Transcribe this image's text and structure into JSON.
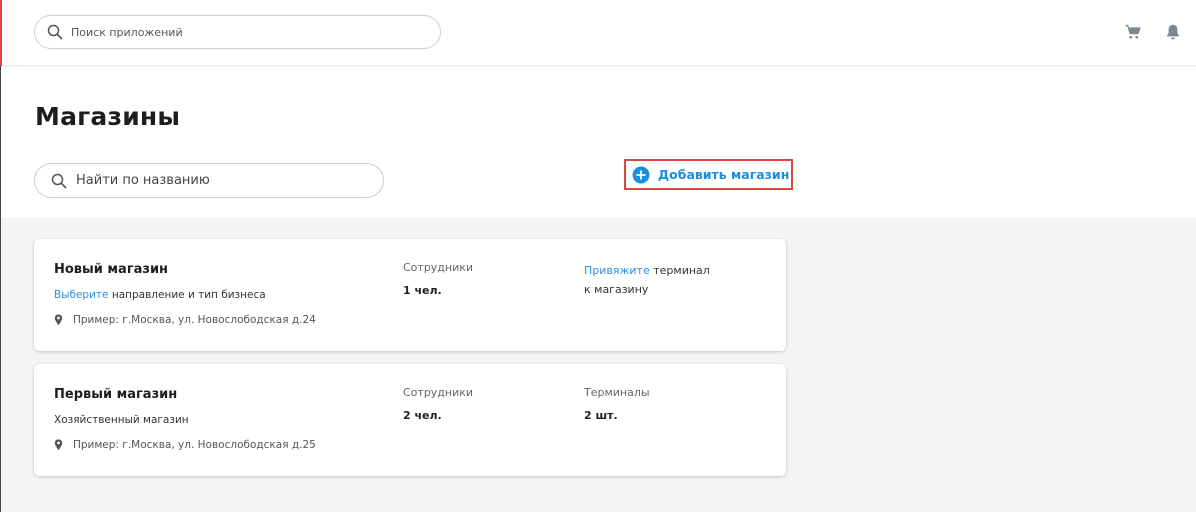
{
  "topbar": {
    "search_placeholder": "Поиск приложений",
    "icons": [
      "search-icon",
      "cart-icon",
      "bell-icon"
    ]
  },
  "page": {
    "title": "Магазины",
    "search_placeholder": "Найти по названию",
    "add_store_label": "Добавить магазин"
  },
  "stores": [
    {
      "name": "Новый магазин",
      "subtitle_link": "Выберите",
      "subtitle_text": " направление и тип бизнеса",
      "address": "Пример: г.Москва, ул. Новослободская д.24",
      "employees_label": "Сотрудники",
      "employees_value": "1 чел.",
      "terminal_link": "Привяжите",
      "terminal_text_1": " терминал",
      "terminal_text_2": "к магазину"
    },
    {
      "name": "Первый магазин",
      "subtitle_text": "Хозяйственный магазин",
      "address": "Пример: г.Москва, ул. Новослободская д.25",
      "employees_label": "Сотрудники",
      "employees_value": "2 чел.",
      "terminals_label": "Терминалы",
      "terminals_value": "2 шт."
    }
  ],
  "colors": {
    "accent": "#1a8fe0",
    "highlight_border": "#d9473f",
    "content_bg": "#f3f4f6"
  }
}
